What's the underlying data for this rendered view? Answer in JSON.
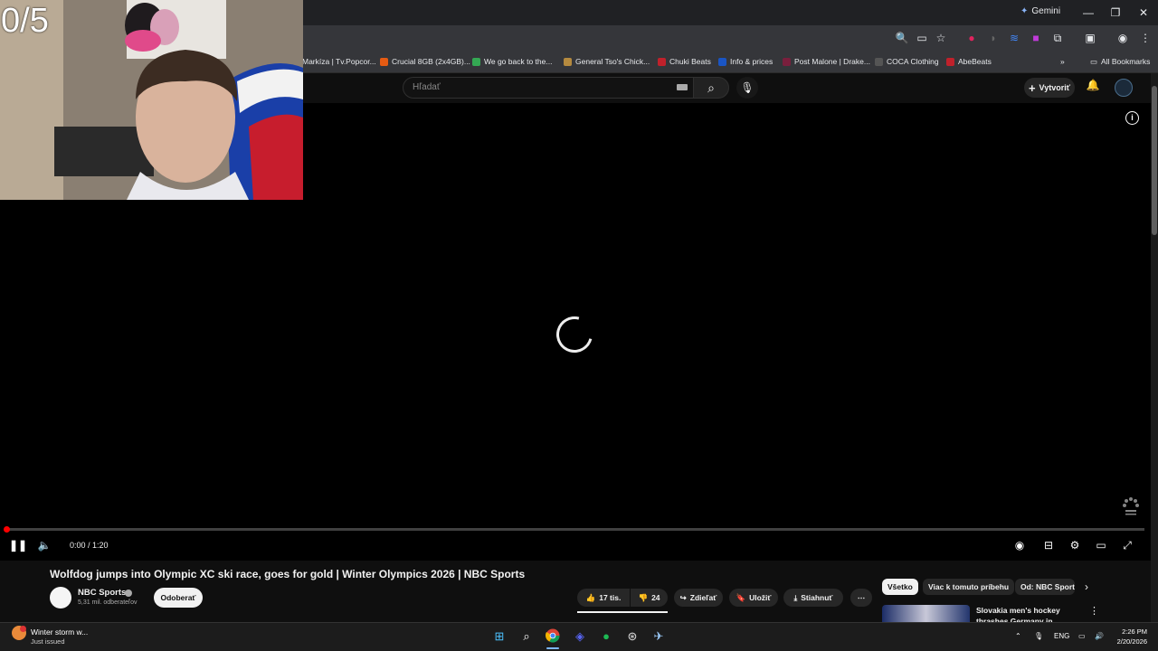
{
  "browser": {
    "gemini_label": "Gemini",
    "win_minimize": "—",
    "win_restore": "❐",
    "win_close": "✕",
    "bookmarks": [
      {
        "label": "Markíza | Tv.Popcor...",
        "color": "#3a3a3a"
      },
      {
        "label": "Crucial 8GB (2x4GB)...",
        "color": "#e55b13"
      },
      {
        "label": "We go back to the...",
        "color": "#34a853"
      },
      {
        "label": "General Tso's Chick...",
        "color": "#b58a3f"
      },
      {
        "label": "Chuki Beats",
        "color": "#c0212b"
      },
      {
        "label": "Info & prices",
        "color": "#1a55c4"
      },
      {
        "label": "Post Malone | Drake...",
        "color": "#7a1f3d"
      },
      {
        "label": "COCA Clothing",
        "color": "#333333"
      },
      {
        "label": "AbeBeats",
        "color": "#c0212b"
      }
    ],
    "all_bookmarks": "All Bookmarks"
  },
  "youtube": {
    "search_placeholder": "Hľadať",
    "create_label": "Vytvoriť"
  },
  "player": {
    "time": "0:00 / 1:20",
    "progress_fraction": 0.0
  },
  "overlay": {
    "counter": "0/5"
  },
  "video": {
    "title": "Wolfdog jumps into Olympic XC ski race, goes for gold | Winter Olympics 2026 | NBC Sports",
    "channel": "NBC Sports",
    "subscribers": "5,31 mil. odberateľov",
    "subscribe_label": "Odoberať",
    "likes": "17 tis.",
    "dislikes": "24",
    "share_label": "Zdieľať",
    "save_label": "Uložiť",
    "download_label": "Stiahnuť"
  },
  "sidebar": {
    "chips": [
      "Všetko",
      "Viac k tomuto príbehu",
      "Od: NBC Sports"
    ],
    "rec_title": "Slovakia men's hockey thrashes Germany in quarterfinal round"
  },
  "taskbar": {
    "weather_title": "Winter storm w...",
    "weather_sub": "Just issued",
    "lang": "ENG",
    "time": "2:26 PM",
    "date": "2/20/2026"
  },
  "colors": {
    "accent": "#ff0000",
    "bg": "#0f0f0f"
  }
}
